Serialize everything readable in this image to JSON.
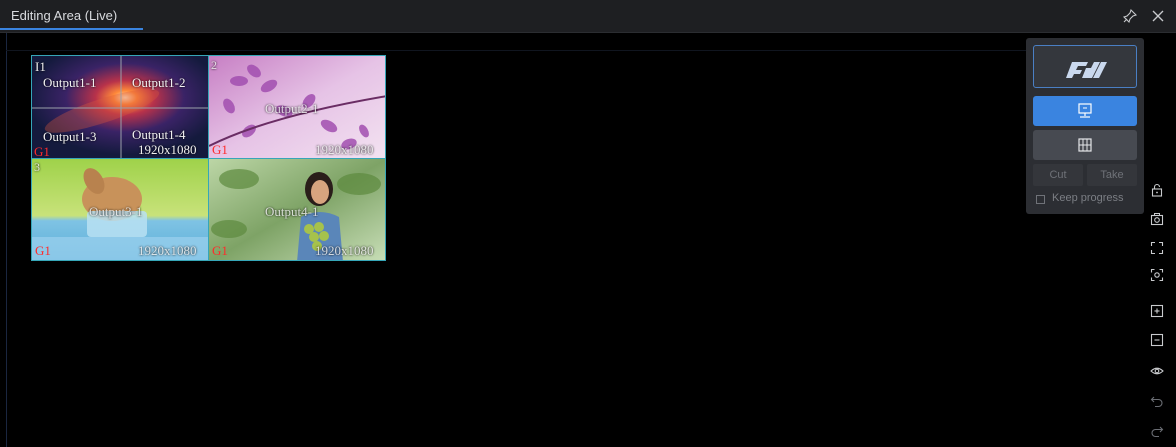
{
  "tab": {
    "label": "Editing Area (Live)"
  },
  "titlebar_icons": [
    "pin-icon",
    "close-icon"
  ],
  "screens": [
    {
      "id_label": "I1",
      "group": "G1",
      "resolution": "1920x1080",
      "outputs": [
        "Output1-1",
        "Output1-2",
        "Output1-3",
        "Output1-4"
      ]
    },
    {
      "id_label": "2",
      "group": "G1",
      "resolution": "1920x1080",
      "outputs": [
        "Output2-1"
      ]
    },
    {
      "id_label": "3",
      "group": "G1",
      "resolution": "1920x1080",
      "outputs": [
        "Output3-1"
      ]
    },
    {
      "id_label": "",
      "group": "G1",
      "resolution": "1920x1080",
      "outputs": [
        "Output4-1"
      ]
    }
  ],
  "panel": {
    "cut_label": "Cut",
    "take_label": "Take",
    "keep_progress_label": "Keep progress",
    "keep_progress_checked": false
  },
  "side_icons": [
    "lock-icon",
    "screenshot-icon",
    "fullscreen-icon",
    "fit-icon",
    "zoom-in-icon",
    "zoom-out-icon",
    "eye-icon",
    "undo-icon",
    "redo-icon"
  ],
  "colors": {
    "accent": "#3a84e0",
    "screen_border": "#36a6b8",
    "group_label": "#ff2b2b"
  }
}
